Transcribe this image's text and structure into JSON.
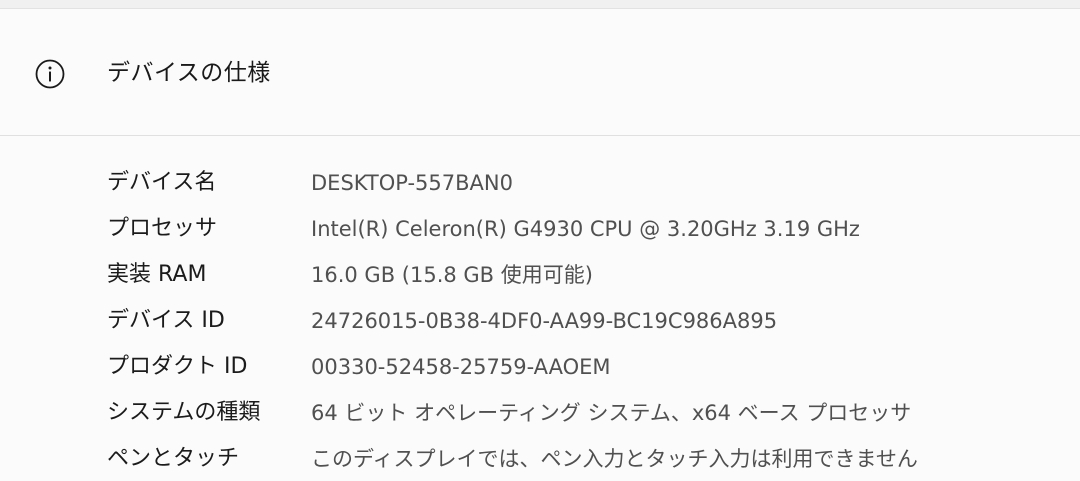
{
  "header": {
    "title": "デバイスの仕様",
    "icon": "info-icon"
  },
  "specs": [
    {
      "label": "デバイス名",
      "value": "DESKTOP-557BAN0"
    },
    {
      "label": "プロセッサ",
      "value": "Intel(R) Celeron(R) G4930 CPU @ 3.20GHz   3.19 GHz"
    },
    {
      "label": "実装 RAM",
      "value": "16.0 GB (15.8 GB 使用可能)"
    },
    {
      "label": "デバイス ID",
      "value": "24726015-0B38-4DF0-AA99-BC19C986A895"
    },
    {
      "label": "プロダクト ID",
      "value": "00330-52458-25759-AAOEM"
    },
    {
      "label": "システムの種類",
      "value": "64 ビット オペレーティング システム、x64 ベース プロセッサ"
    },
    {
      "label": "ペンとタッチ",
      "value": "このディスプレイでは、ペン入力とタッチ入力は利用できません"
    }
  ]
}
